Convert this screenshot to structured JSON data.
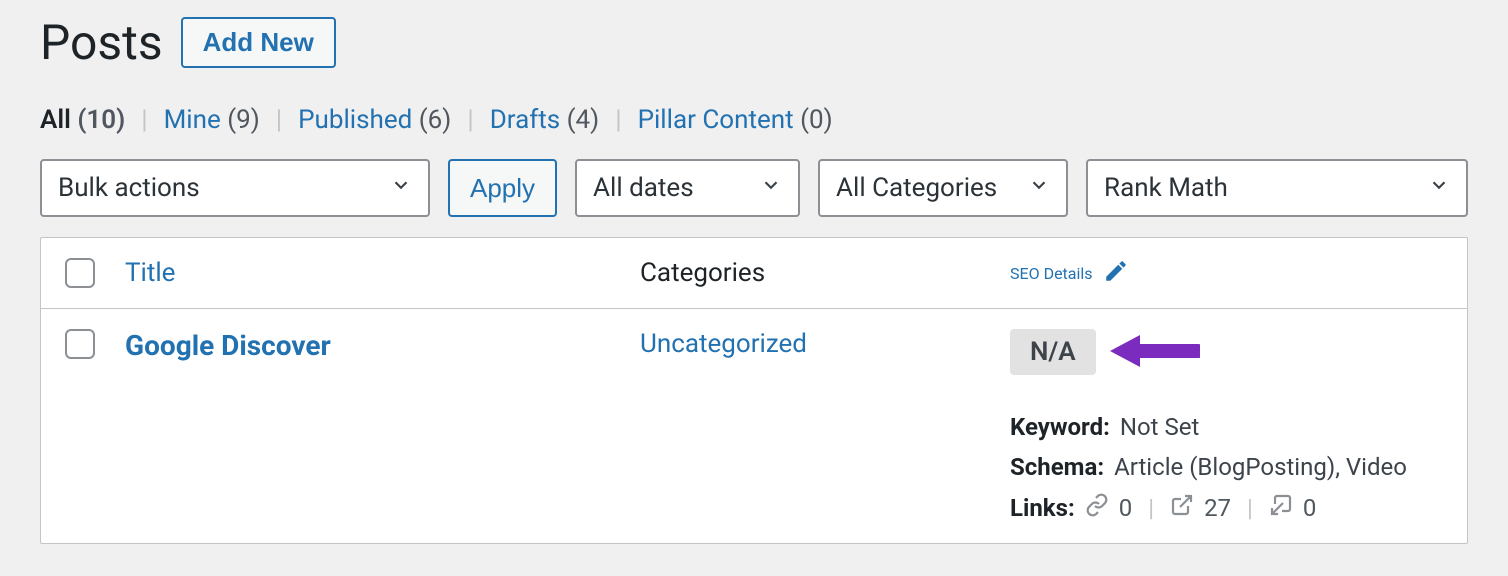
{
  "header": {
    "title": "Posts",
    "add_new": "Add New"
  },
  "tabs": [
    {
      "label": "All",
      "count": "(10)",
      "active": true
    },
    {
      "label": "Mine",
      "count": "(9)",
      "active": false
    },
    {
      "label": "Published",
      "count": "(6)",
      "active": false
    },
    {
      "label": "Drafts",
      "count": "(4)",
      "active": false
    },
    {
      "label": "Pillar Content",
      "count": "(0)",
      "active": false
    }
  ],
  "controls": {
    "bulk": "Bulk actions",
    "apply": "Apply",
    "dates": "All dates",
    "categories": "All Categories",
    "rankmath": "Rank Math"
  },
  "columns": {
    "title": "Title",
    "categories": "Categories",
    "seo": "SEO Details"
  },
  "row": {
    "title": "Google Discover",
    "category": "Uncategorized",
    "seo": {
      "badge": "N/A",
      "keyword_label": "Keyword:",
      "keyword_value": "Not Set",
      "schema_label": "Schema:",
      "schema_value": "Article (BlogPosting), Video",
      "links_label": "Links:",
      "l0": "0",
      "l1": "27",
      "l2": "0"
    }
  }
}
